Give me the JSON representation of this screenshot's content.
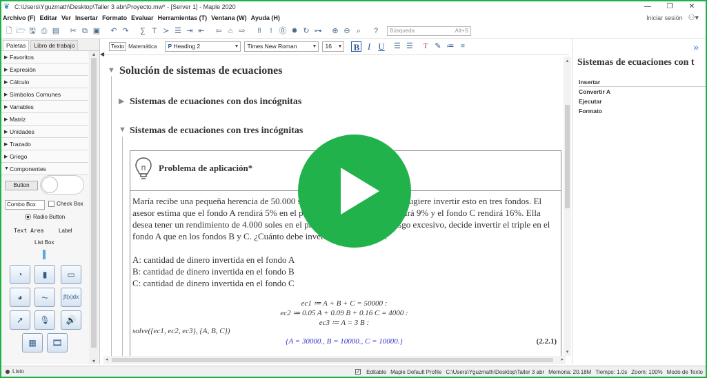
{
  "window": {
    "title": "C:\\Users\\Yguzmath\\Desktop\\Taller 3 abr\\Proyecto.mw* - [Server 1] - Maple 2020",
    "controls": [
      "—",
      "❐",
      "✕"
    ]
  },
  "menu": [
    "Archivo (F)",
    "Editar",
    "Ver",
    "Insertar",
    "Formato",
    "Evaluar",
    "Herramientas (T)",
    "Ventana (W)",
    "Ayuda (H)"
  ],
  "signin": "Iniciar sesión",
  "search": {
    "placeholder": "Búsqueda",
    "shortcut": "Alt+S"
  },
  "left_panel": {
    "tabs": [
      "Paletas",
      "Libro de trabajo"
    ],
    "palettes": [
      "Favoritos",
      "Expresión",
      "Cálculo",
      "Símbolos Comunes",
      "Variables",
      "Matriz",
      "Unidades",
      "Trazado",
      "Griego",
      "Componentes"
    ],
    "components": {
      "button": "Button",
      "combo": "Combo Box",
      "check": "Check Box",
      "radio": "Radio Button",
      "textarea": "Text Area",
      "label": "Label",
      "listbox": "List Box"
    }
  },
  "context_bar": {
    "mode_text": "Texto",
    "mode_math": "Matemática",
    "style": "Heading 2",
    "font": "Times New Roman",
    "size": "16"
  },
  "document": {
    "h1": "Solución de sistemas de ecuaciones",
    "h2a": "Sistemas de ecuaciones con dos incógnitas",
    "h2b": "Sistemas de ecuaciones con tres incógnitas",
    "problem_title": "Problema de aplicación*",
    "paragraph": "María recibe una pequeña herencia de 50.000 soles. Un asesor financiero le sugiere invertir esto en tres fondos. El asesor estima que el fondo A rendirá 5% en el próximo año, el fondo B rendirá 9% y el fondo C rendirá 16%. Ella desea tener un rendimiento de 4.000 soles en el primer año. Para evitar riesgo excesivo, decide invertir el triple en el fondo A que en los fondos B y C. ¿Cuánto debe invertir en cada fondo?",
    "var_a": "A: cantidad de dinero invertida en el fondo A",
    "var_b": "B: cantidad de dinero invertida en el fondo B",
    "var_c": "C: cantidad de dinero invertida en el fondo C",
    "eq1": "ec1 ≔ A + B + C = 50000 :",
    "eq2": "ec2 ≔ 0.05 A + 0.09 B + 0.16 C = 4000 :",
    "eq3": "ec3 ≔ A = 3 B :",
    "solve": "solve({ec1, ec2, ec3}, {A, B, C})",
    "result": "{A = 30000., B = 10000., C = 10000.}",
    "label": "(2.2.1)"
  },
  "right_panel": {
    "title": "Sistemas de ecuaciones con t",
    "items": [
      "Insertar",
      "Convertir A",
      "Ejecutar",
      "Formato"
    ]
  },
  "status": {
    "left": "Listo",
    "editable": "Editable",
    "profile": "Maple Default Profile",
    "path": "C:\\Users\\Yguzmath\\Desktop\\Taller 3 abr",
    "memory": "Memoria: 20.18M",
    "time": "Tiempo: 1.0s",
    "zoom": "Zoom: 100%",
    "mode": "Modo de Texto"
  },
  "colors": {
    "border": "#1fb141",
    "play": "#22b24c",
    "math_result": "#3333cc"
  }
}
